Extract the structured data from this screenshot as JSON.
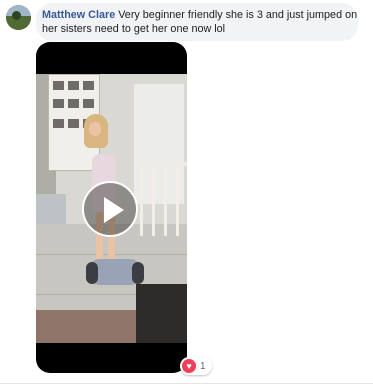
{
  "comment": {
    "author": "Matthew Clare",
    "text": "Very beginner friendly she is 3 and just jumped on her sisters need to get her one now lol"
  },
  "video": {
    "play_icon": "play-icon"
  },
  "reactions": {
    "icon": "heart-icon",
    "count": "1"
  },
  "colors": {
    "author_link": "#385898",
    "bubble_bg": "#f2f3f5",
    "love_red": "#f33e58"
  }
}
